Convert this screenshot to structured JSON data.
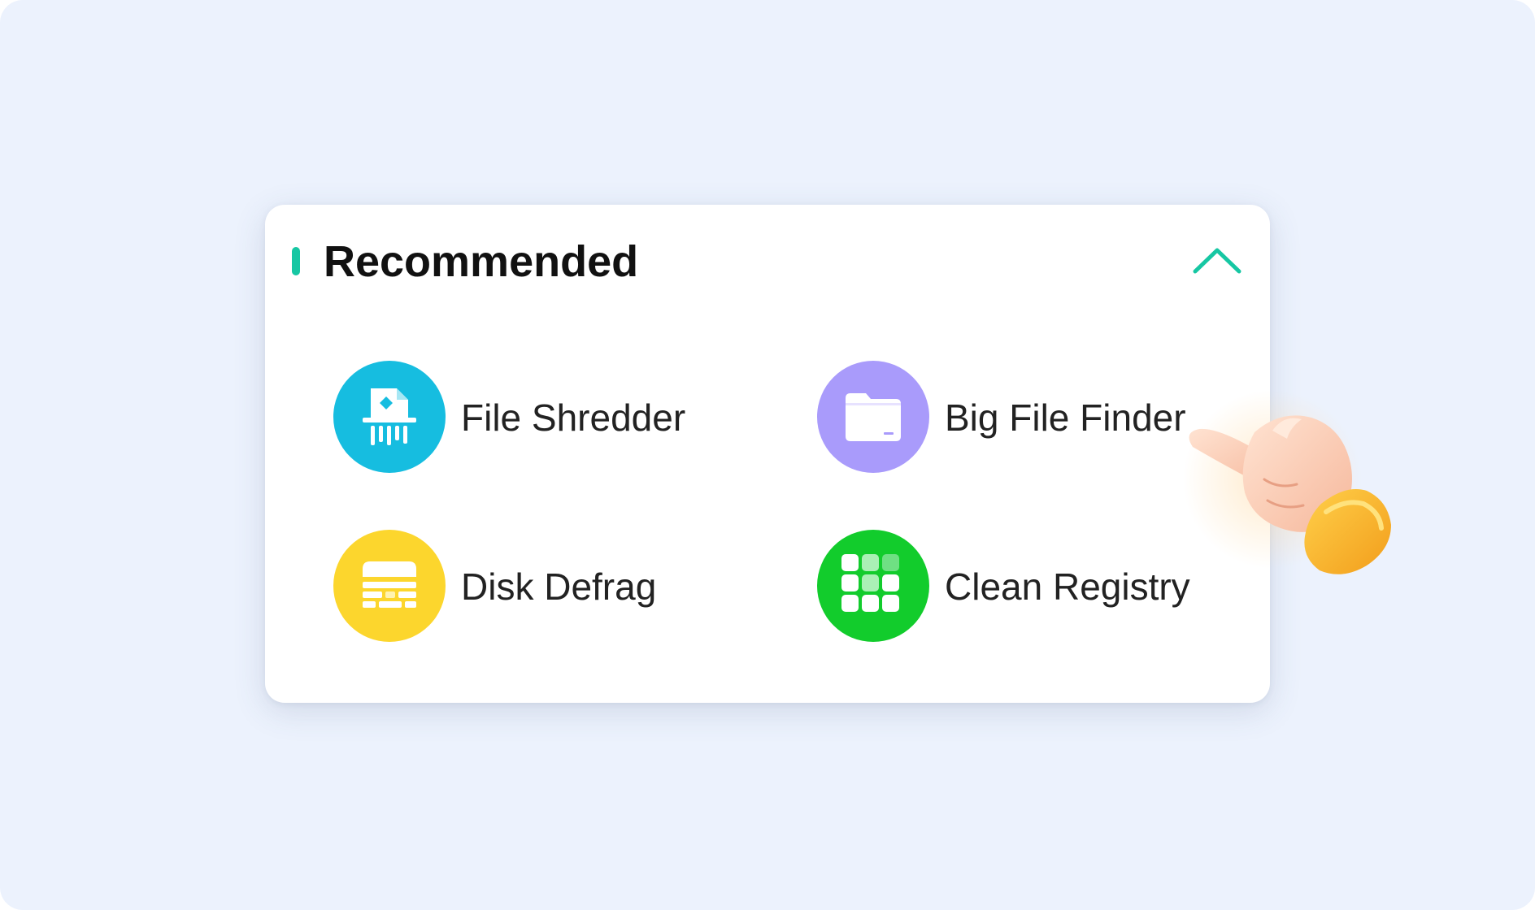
{
  "colors": {
    "background": "#ecf2fd",
    "card": "#ffffff",
    "accent": "#16c7a3",
    "title_text": "#111111",
    "item_text": "#222222"
  },
  "section": {
    "title": "Recommended",
    "collapse_icon": "chevron-up-icon"
  },
  "tools": [
    {
      "label": "File Shredder",
      "icon": "file-shredder-icon",
      "color": "#16bde0"
    },
    {
      "label": "Big File Finder",
      "icon": "folder-icon",
      "color": "#a99bfb"
    },
    {
      "label": "Disk Defrag",
      "icon": "disk-defrag-icon",
      "color": "#fcd62d"
    },
    {
      "label": "Clean Registry",
      "icon": "registry-grid-icon",
      "color": "#12cc2c"
    }
  ],
  "pointer": {
    "icon": "pointing-hand-icon"
  }
}
